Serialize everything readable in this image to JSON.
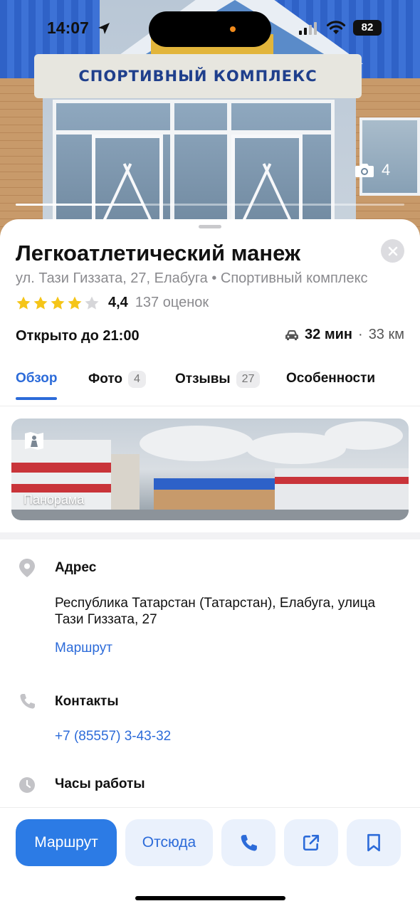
{
  "status_bar": {
    "time": "14:07",
    "battery": "82"
  },
  "hero": {
    "sign_text": "СПОРТИВНЫЙ КОМПЛЕКС",
    "photo_count": "4",
    "progress_fraction": 0.33
  },
  "place": {
    "title": "Легкоатлетический манеж",
    "subtitle": "ул. Тази Гиззата, 27, Елабуга • Спортивный комплекс",
    "rating_value": "4,4",
    "rating_stars": 4,
    "rating_count": "137 оценок",
    "open_status": "Открыто до 21:00",
    "route_mins": "32 мин",
    "route_separator": "·",
    "route_distance": "33 км"
  },
  "tabs": [
    {
      "label": "Обзор",
      "badge": ""
    },
    {
      "label": "Фото",
      "badge": "4"
    },
    {
      "label": "Отзывы",
      "badge": "27"
    },
    {
      "label": "Особенности",
      "badge": ""
    }
  ],
  "panorama": {
    "label": "Панорама"
  },
  "address": {
    "title": "Адрес",
    "text": "Республика Татарстан (Татарстан), Елабуга, улица Тази Гиззата, 27",
    "route_link": "Маршрут"
  },
  "contacts": {
    "title": "Контакты",
    "phone": "+7 (85557) 3-43-32"
  },
  "hours": {
    "title": "Часы работы"
  },
  "actions": {
    "route": "Маршрут",
    "from_here": "Отсюда"
  },
  "colors": {
    "accent": "#2c7be5",
    "link": "#2c6bd9",
    "star": "#f5c518",
    "star_empty": "#d6d6d9"
  }
}
